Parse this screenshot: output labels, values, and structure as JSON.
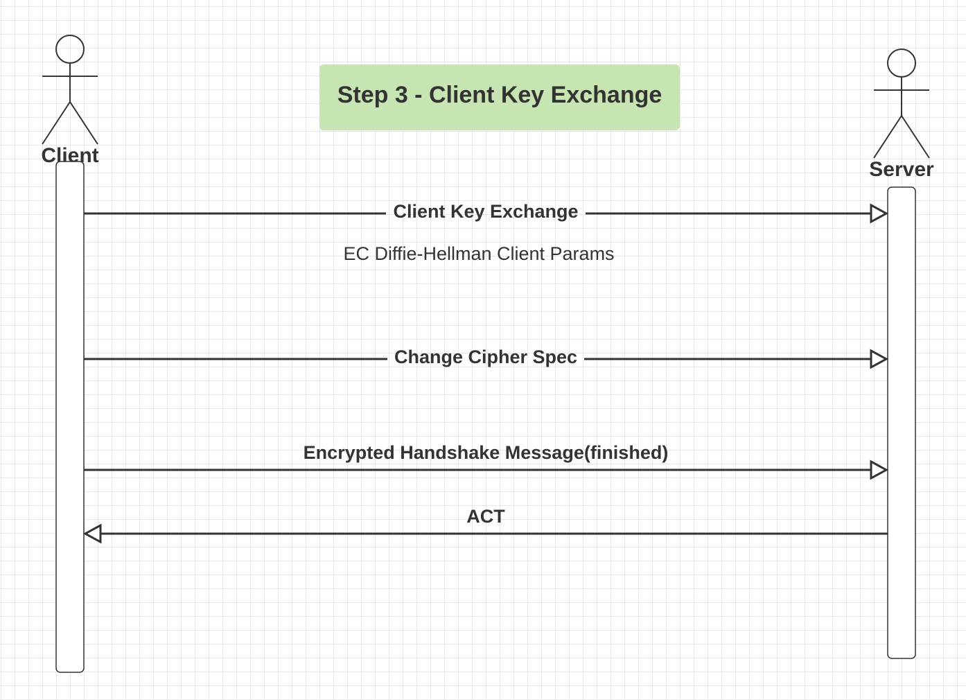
{
  "diagram": {
    "title": "Step 3 - Client Key Exchange",
    "title_bg_color": "#c7e5b2",
    "line_color": "#333333",
    "actors": [
      {
        "id": "client",
        "label": "Client"
      },
      {
        "id": "server",
        "label": "Server"
      }
    ],
    "messages": [
      {
        "label": "Client Key Exchange",
        "from": "client",
        "to": "server",
        "note": "EC Diffie-Hellman Client Params"
      },
      {
        "label": "Change Cipher Spec",
        "from": "client",
        "to": "server"
      },
      {
        "label": "Encrypted Handshake Message(finished)",
        "from": "client",
        "to": "server"
      },
      {
        "label": "ACT",
        "from": "server",
        "to": "client"
      }
    ]
  }
}
